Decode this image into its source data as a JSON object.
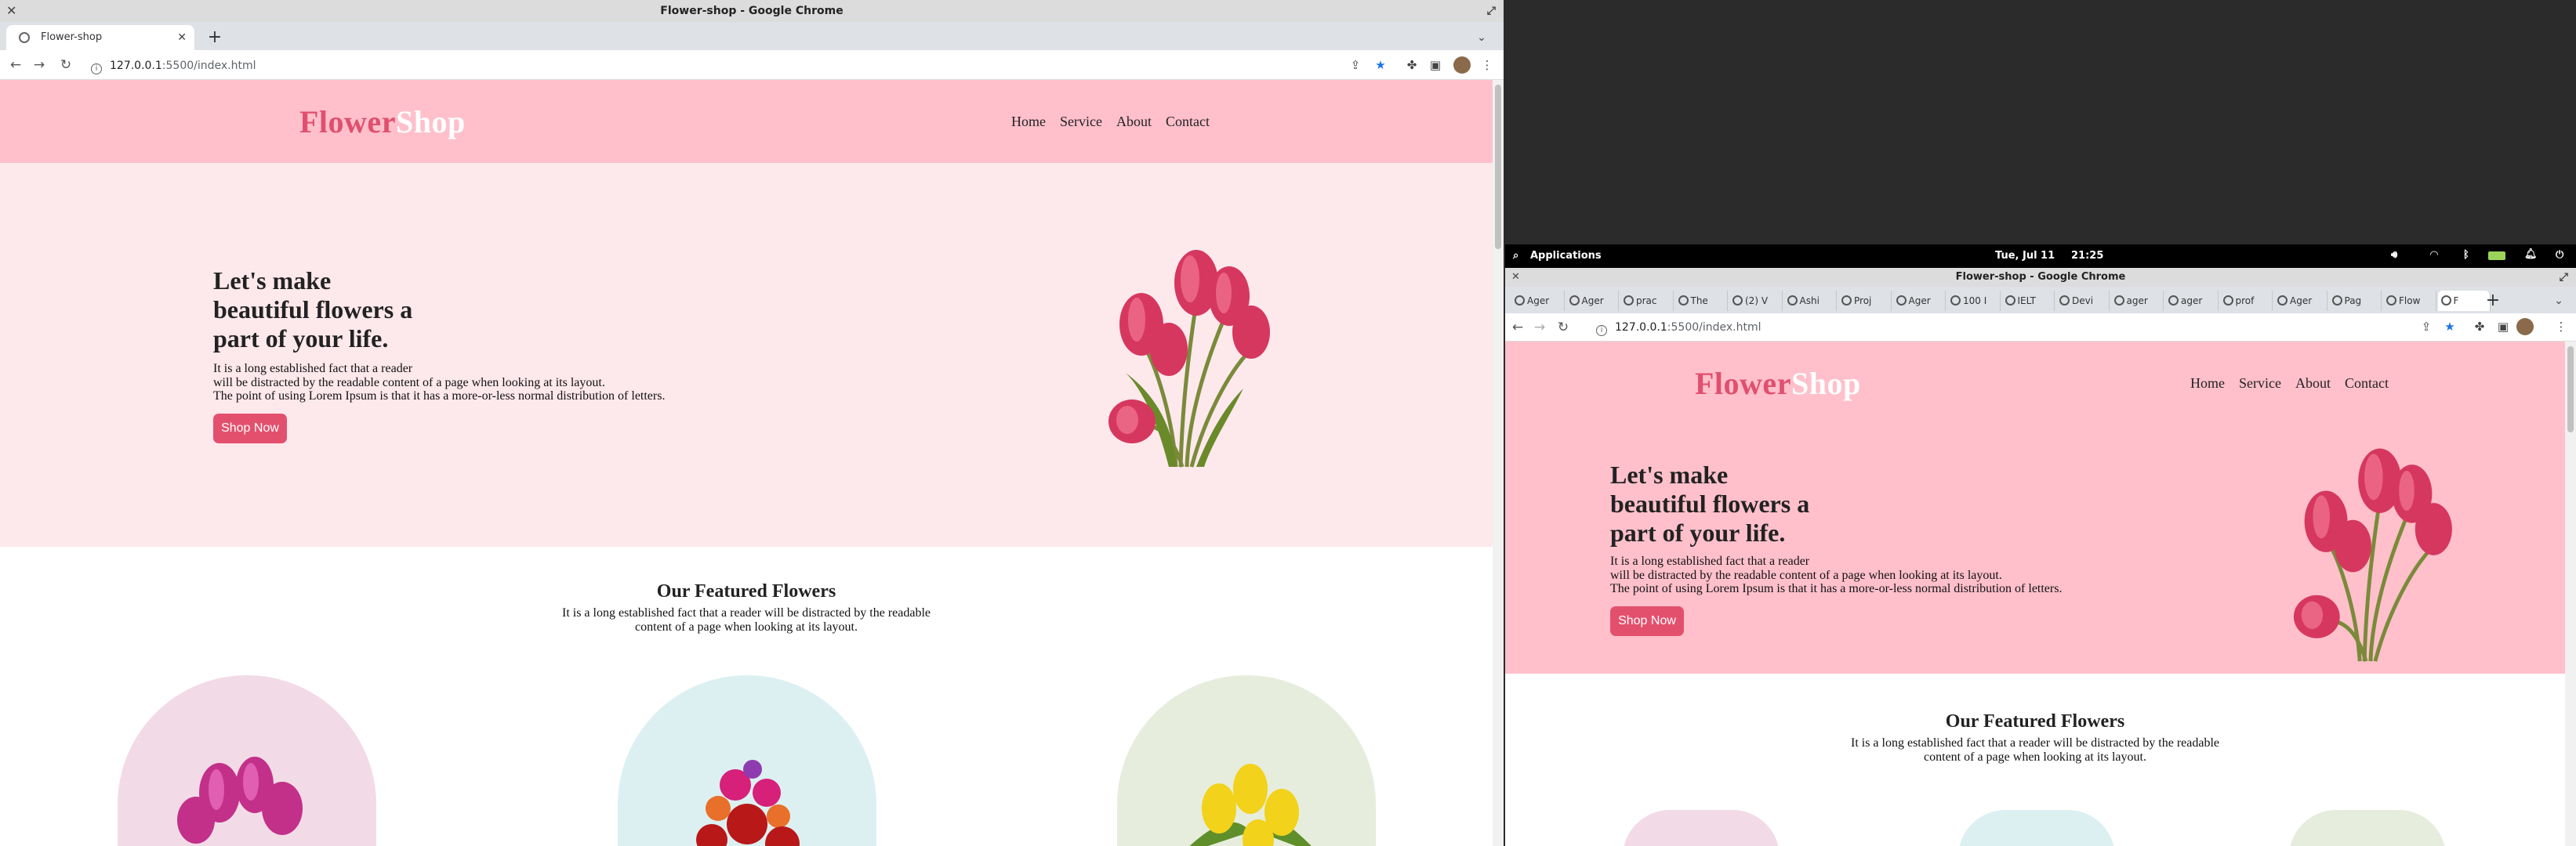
{
  "left_window": {
    "title": "Flower-shop - Google Chrome",
    "tab_label": "Flower-shop",
    "url_host": "127.0.0.1",
    "url_rest": ":5500/index.html"
  },
  "right_window": {
    "title": "Flower-shop - Google Chrome",
    "url_host": "127.0.0.1",
    "url_rest": ":5500/index.html",
    "tabs": [
      "Ager",
      "Ager",
      "prac",
      "The",
      "(2) V",
      "Ashi",
      "Proj",
      "Ager",
      "100 I",
      "IELT",
      "Devi",
      "ager",
      "ager",
      "prof",
      "Ager",
      "Pag",
      "Flow",
      "F"
    ]
  },
  "gnome_bar": {
    "applications": "Applications",
    "date": "Tue, Jul 11",
    "time": "21:25"
  },
  "site": {
    "logo_part1": "Flower",
    "logo_part2": "Shop",
    "nav": [
      "Home",
      "Service",
      "About",
      "Contact"
    ],
    "hero_title_lines": [
      "Let's make",
      "beautiful flowers a",
      "part of your life."
    ],
    "hero_text_lines": [
      "It is a long established fact that a reader",
      "will be distracted by the readable content of a page when looking at its layout.",
      "The point of using Lorem Ipsum is that it has a more-or-less normal distribution of letters."
    ],
    "shop_button": "Shop Now",
    "featured_title": "Our Featured Flowers",
    "featured_text_lines": [
      "It is a long established fact that a reader will be distracted by the readable",
      "content of a page when looking at its layout."
    ]
  },
  "colors": {
    "header_pink": "#ffc0cb",
    "hero_bg": "#fde8ec",
    "accent": "#e3506d",
    "arch1": "#f2dbe6",
    "arch2": "#dcf0f2",
    "arch3": "#e6eddc"
  },
  "icons": [
    "close-icon",
    "maximize-icon",
    "back-arrow-icon",
    "forward-arrow-icon",
    "reload-icon",
    "info-icon",
    "share-icon",
    "star-icon",
    "extensions-icon",
    "sidepanel-icon",
    "profile-avatar",
    "kebab-menu-icon",
    "search-icon",
    "volume-icon",
    "wifi-icon",
    "bluetooth-icon",
    "battery-icon",
    "notification-icon",
    "power-icon"
  ]
}
